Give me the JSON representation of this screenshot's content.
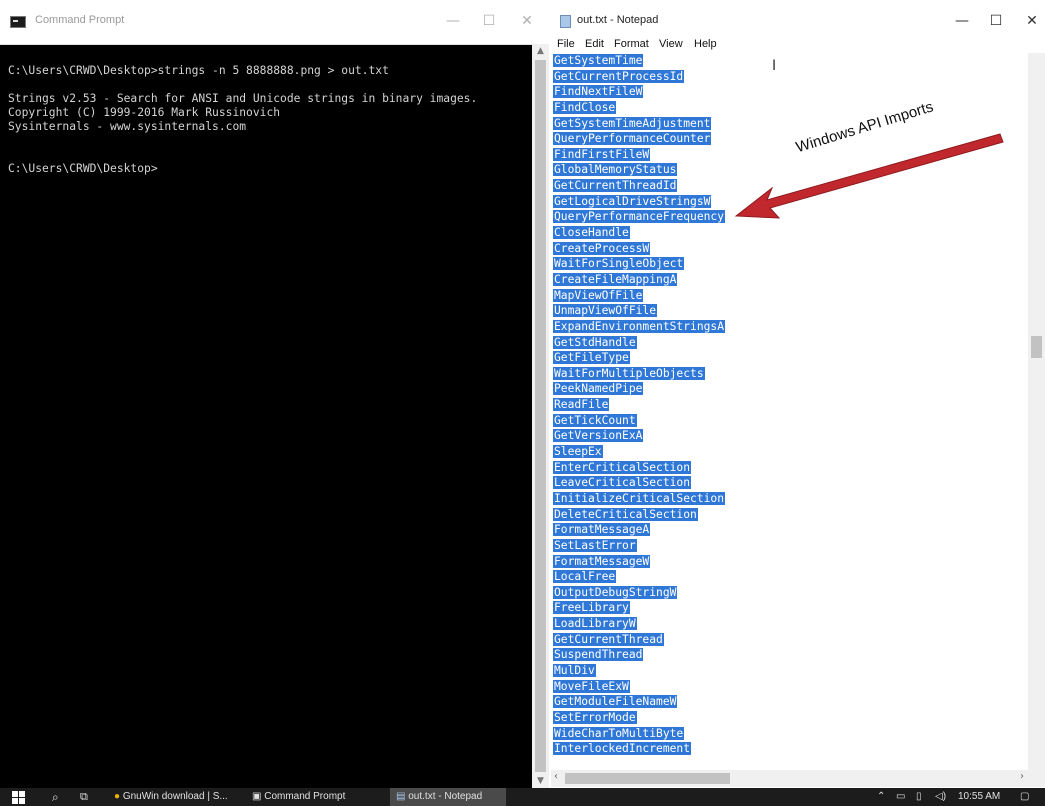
{
  "cmd": {
    "title": "Command Prompt",
    "lines": [
      "",
      "C:\\Users\\CRWD\\Desktop>strings -n 5 8888888.png > out.txt",
      "",
      "Strings v2.53 - Search for ANSI and Unicode strings in binary images.",
      "Copyright (C) 1999-2016 Mark Russinovich",
      "Sysinternals - www.sysinternals.com",
      "",
      "",
      "C:\\Users\\CRWD\\Desktop>"
    ]
  },
  "notepad": {
    "title": "out.txt - Notepad",
    "menu": [
      "File",
      "Edit",
      "Format",
      "View",
      "Help"
    ],
    "lines": [
      "GetSystemTime",
      "GetCurrentProcessId",
      "FindNextFileW",
      "FindClose",
      "GetSystemTimeAdjustment",
      "QueryPerformanceCounter",
      "FindFirstFileW",
      "GlobalMemoryStatus",
      "GetCurrentThreadId",
      "GetLogicalDriveStringsW",
      "QueryPerformanceFrequency",
      "CloseHandle",
      "CreateProcessW",
      "WaitForSingleObject",
      "CreateFileMappingA",
      "MapViewOfFile",
      "UnmapViewOfFile",
      "ExpandEnvironmentStringsA",
      "GetStdHandle",
      "GetFileType",
      "WaitForMultipleObjects",
      "PeekNamedPipe",
      "ReadFile",
      "GetTickCount",
      "GetVersionExA",
      "SleepEx",
      "EnterCriticalSection",
      "LeaveCriticalSection",
      "InitializeCriticalSection",
      "DeleteCriticalSection",
      "FormatMessageA",
      "SetLastError",
      "FormatMessageW",
      "LocalFree",
      "OutputDebugStringW",
      "FreeLibrary",
      "LoadLibraryW",
      "GetCurrentThread",
      "SuspendThread",
      "MulDiv",
      "MoveFileExW",
      "GetModuleFileNameW",
      "SetErrorMode",
      "WideCharToMultiByte",
      "InterlockedIncrement"
    ]
  },
  "annotation": {
    "text": "Windows API Imports",
    "arrow_color": "#c0282d"
  },
  "taskbar": {
    "items": [
      {
        "label": "GnuWin download | S..."
      },
      {
        "label": "Command Prompt"
      },
      {
        "label": "out.txt - Notepad"
      }
    ],
    "time": "10:55 AM"
  },
  "colors": {
    "selection": "#3078d7",
    "console_bg": "#000000",
    "taskbar_bg": "#1c1c1c"
  }
}
